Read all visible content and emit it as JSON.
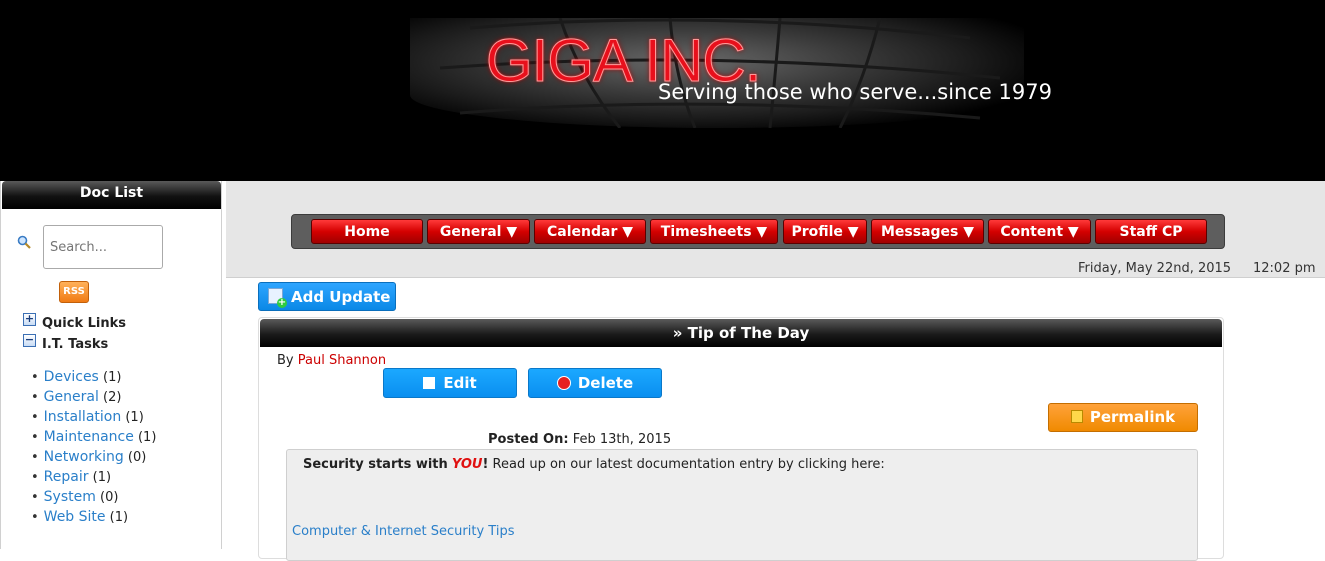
{
  "header": {
    "brand": "GIGA INC.",
    "tagline": "Serving those who serve...since 1979"
  },
  "sidebar": {
    "title": "Doc List",
    "search_placeholder": "Search...",
    "rss_label": "RSS",
    "sections": [
      {
        "label": "Quick Links",
        "toggle": "+"
      },
      {
        "label": "I.T. Tasks",
        "toggle": "−"
      }
    ],
    "categories": [
      {
        "name": "Devices",
        "count": "(1)"
      },
      {
        "name": "General",
        "count": "(2)"
      },
      {
        "name": "Installation",
        "count": "(1)"
      },
      {
        "name": "Maintenance",
        "count": "(1)"
      },
      {
        "name": "Networking",
        "count": "(0)"
      },
      {
        "name": "Repair",
        "count": "(1)"
      },
      {
        "name": "System",
        "count": "(0)"
      },
      {
        "name": "Web Site",
        "count": "(1)"
      }
    ]
  },
  "nav": {
    "items": [
      {
        "label": "Home"
      },
      {
        "label": "General ▼"
      },
      {
        "label": "Calendar ▼"
      },
      {
        "label": "Timesheets ▼"
      },
      {
        "label": "Profile ▼"
      },
      {
        "label": "Messages ▼"
      },
      {
        "label": "Content ▼"
      },
      {
        "label": "Staff CP"
      }
    ]
  },
  "status": {
    "date": "Friday, May 22nd, 2015",
    "time": "12:02 pm"
  },
  "content": {
    "add_update_label": "Add Update",
    "panel_title": "» Tip of The Day",
    "by_label": "By",
    "author": "Paul Shannon",
    "edit_label": "Edit",
    "delete_label": "Delete",
    "permalink_label": "Permalink",
    "posted_label": "Posted On:",
    "posted_date": "Feb 13th, 2015",
    "body_prefix": "Security starts with",
    "body_emphasis": "YOU",
    "body_exclaim": "!",
    "body_rest": " Read up on our latest documentation entry by clicking here:",
    "body_link": "Computer & Internet Security Tips"
  },
  "colors": {
    "nav_red": "#d40000",
    "button_blue": "#0a8ff0",
    "permalink_orange": "#f08a00",
    "link_blue": "#2a7fc9",
    "author_red": "#cc0000"
  },
  "icons": [
    "search-icon",
    "rss-icon",
    "plus-icon",
    "minus-icon",
    "add-document-icon",
    "edit-icon",
    "delete-icon",
    "permalink-icon"
  ]
}
